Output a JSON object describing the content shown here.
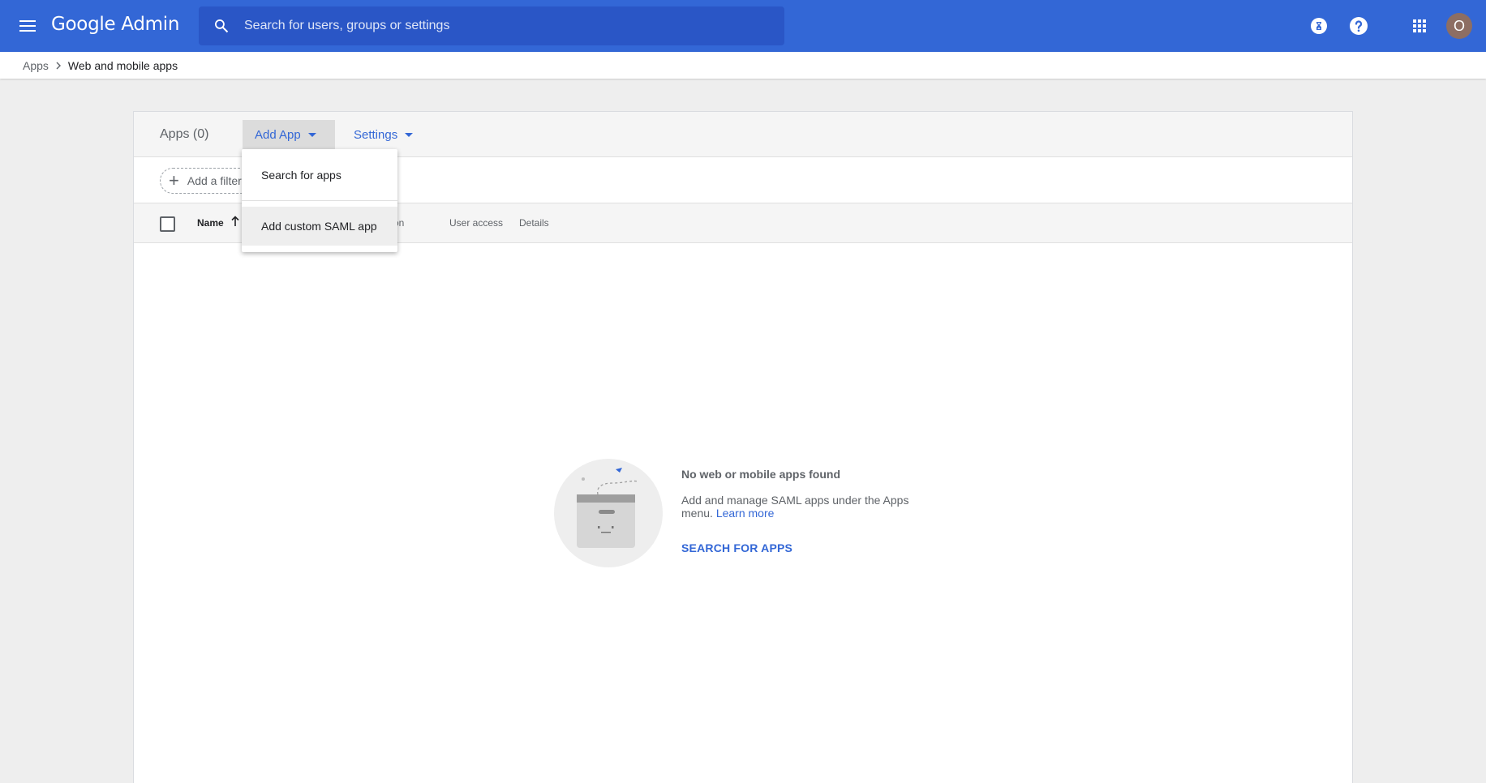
{
  "topbar": {
    "brand": "Google Admin",
    "search_placeholder": "Search for users, groups or settings",
    "avatar_initial": "O",
    "color": "#3367d6"
  },
  "breadcrumb": {
    "parent": "Apps",
    "current": "Web and mobile apps"
  },
  "card": {
    "title": "Apps (0)",
    "add_app_label": "Add App",
    "settings_label": "Settings",
    "filter_label": "Add a filter",
    "columns": {
      "name": "Name",
      "hidden_partial": "on",
      "user_access": "User access",
      "details": "Details"
    }
  },
  "dropdown": {
    "items": [
      {
        "label": "Search for apps"
      },
      {
        "label": "Add custom SAML app"
      }
    ]
  },
  "empty_state": {
    "title": "No web or mobile apps found",
    "description": "Add and manage SAML apps under the Apps menu.",
    "learn_more": "Learn more",
    "action": "SEARCH FOR APPS"
  }
}
